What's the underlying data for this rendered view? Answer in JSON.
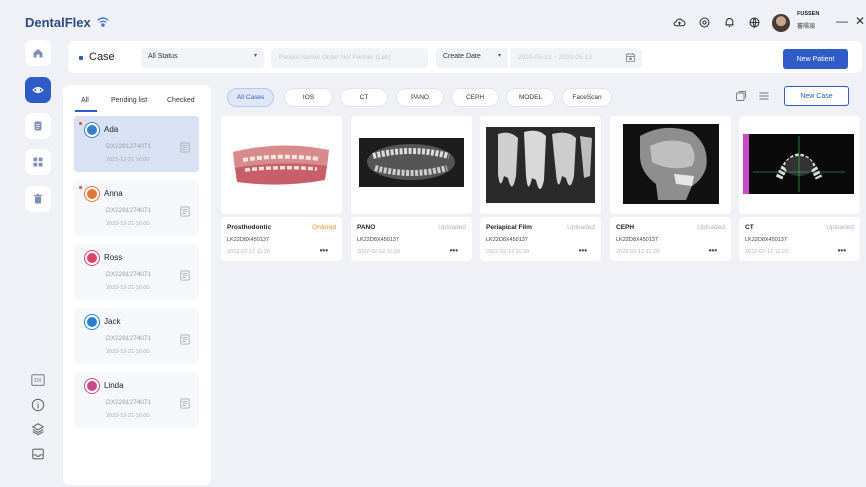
{
  "app": {
    "title": "DentalFlex"
  },
  "user": {
    "tag": "FUSSEN",
    "name": "FUSSEN",
    "subtitle": "蕃陽璃"
  },
  "window": {
    "minimize": "—",
    "close": "✕"
  },
  "header": {
    "title": "Case",
    "status_select": "All Status",
    "search_placeholder": "Patient Name/ Order No/ Partner (Lab)",
    "date_select": "Create Date",
    "date_range_placeholder": "2020-05-13 ~ 2020-05-13",
    "new_patient": "New Patient"
  },
  "patient_tabs": [
    "All",
    "Pending list",
    "Checked"
  ],
  "patients": [
    {
      "name": "Ada",
      "id": "DX2281274071",
      "date": "2023-12-21 16:00",
      "unread": true,
      "active": true,
      "color": "#3b82c4"
    },
    {
      "name": "Anna",
      "id": "DX2281274071",
      "date": "2023-12-21 16:00",
      "unread": true,
      "active": false,
      "color": "#e0763a"
    },
    {
      "name": "Ross",
      "id": "DX2281274071",
      "date": "2023-12-21 16:00",
      "unread": false,
      "active": false,
      "color": "#d9456b"
    },
    {
      "name": "Jack",
      "id": "DX2281274071",
      "date": "2023-12-21 16:00",
      "unread": false,
      "active": false,
      "color": "#2b7fd0"
    },
    {
      "name": "Linda",
      "id": "DX2281274071",
      "date": "2023-12-21 16:00",
      "unread": false,
      "active": false,
      "color": "#c94a8a"
    }
  ],
  "case_filters": [
    "All Cases",
    "IOS",
    "CT",
    "PANO",
    "CEPH",
    "MODEL",
    "FaceScan"
  ],
  "new_case": "New Case",
  "cases": [
    {
      "title": "Prosthodontic",
      "status": "Ordered",
      "code": "LK22D8X450137",
      "date": "2022-02-12 11:20",
      "more": "•••",
      "kind": "model"
    },
    {
      "title": "PANO",
      "status": "Uploaded",
      "code": "LK22D8X450137",
      "date": "2022-02-12 11:20",
      "more": "•••",
      "kind": "pano"
    },
    {
      "title": "Periapical Film",
      "status": "Uploaded",
      "code": "LK22D8X450137",
      "date": "2022-02-12 11:20",
      "more": "•••",
      "kind": "periapical"
    },
    {
      "title": "CEPH",
      "status": "Uploaded",
      "code": "LK22D8X450137",
      "date": "2022-02-12 11:20",
      "more": "•••",
      "kind": "ceph"
    },
    {
      "title": "CT",
      "status": "Uploaded",
      "code": "LK22D8X450137",
      "date": "2022-02-12 11:20",
      "more": "•••",
      "kind": "ct"
    }
  ],
  "sidebar_bottom": {
    "dx_label": "DX"
  },
  "colors": {
    "accent": "#2f5cc7",
    "ordered": "#f0902a"
  }
}
